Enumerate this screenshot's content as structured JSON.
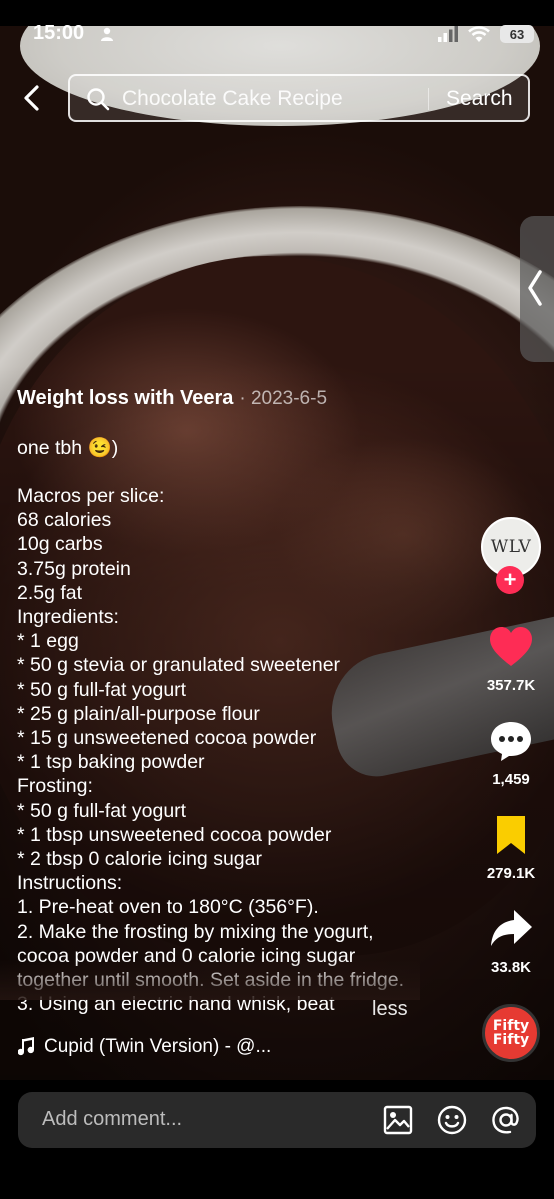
{
  "status": {
    "time": "15:00",
    "battery": "63"
  },
  "search": {
    "query": "Chocolate Cake Recipe",
    "button": "Search"
  },
  "post": {
    "author": "Weight loss with Veera",
    "date": "· 2023-6-5",
    "caption": "one tbh 😉)\n\nMacros per slice:\n68 calories\n10g carbs\n3.75g protein\n2.5g fat\nIngredients:\n* 1 egg\n* 50 g stevia or granulated sweetener\n* 50 g full-fat yogurt\n* 25 g plain/all-purpose flour\n* 15 g unsweetened cocoa powder\n* 1 tsp baking powder\nFrosting:\n* 50 g full-fat yogurt\n* 1 tbsp unsweetened cocoa powder\n* 2 tbsp 0 calorie icing sugar\nInstructions:\n1. Pre-heat oven to 180°C (356°F).\n2. Make the frosting by mixing the yogurt, cocoa powder and 0 calorie icing sugar together until smooth. Set aside in the fridge.\n3. Using an electric hand whisk, beat",
    "less_label": "less",
    "music": "Cupid (Twin Version) - @..."
  },
  "rail": {
    "avatar_text": "WLV",
    "likes": "357.7K",
    "comments": "1,459",
    "saves": "279.1K",
    "shares": "33.8K",
    "disc_text": "Fifty Fifty"
  },
  "comment_bar": {
    "placeholder": "Add comment..."
  },
  "colors": {
    "like": "#fe2c55",
    "save": "#facd00",
    "follow": "#fe2c55"
  }
}
